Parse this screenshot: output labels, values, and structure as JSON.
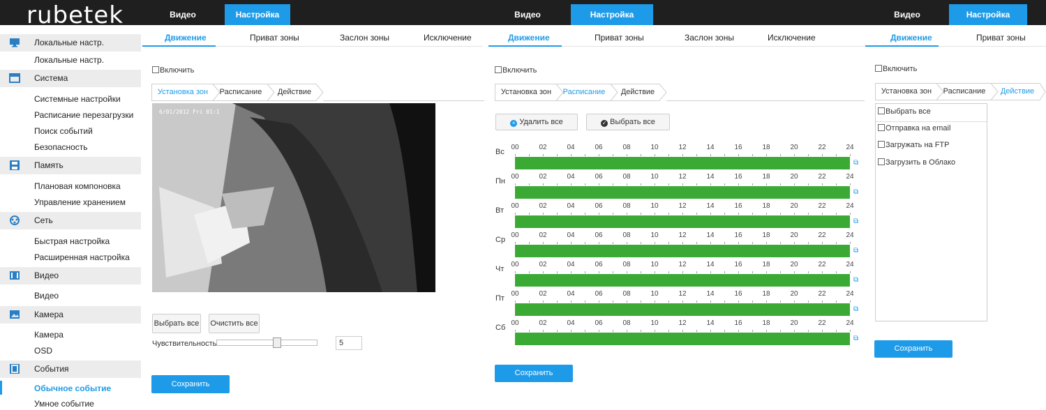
{
  "brand": {
    "logo": "rubetek"
  },
  "topnav": {
    "video": "Видео",
    "settings": "Настройка"
  },
  "sidebar": {
    "groups": [
      {
        "label": "Локальные настр.",
        "icon": "monitor-icon",
        "items": [
          "Локальные настр."
        ]
      },
      {
        "label": "Система",
        "icon": "system-icon",
        "items": [
          "Системные настройки",
          "Расписание перезагрузки",
          "Поиск событий",
          "Безопасность"
        ]
      },
      {
        "label": "Память",
        "icon": "storage-icon",
        "items": [
          "Плановая компоновка",
          "Управление хранением"
        ]
      },
      {
        "label": "Сеть",
        "icon": "network-icon",
        "items": [
          "Быстрая настройка",
          "Расширенная настройка"
        ]
      },
      {
        "label": "Видео",
        "icon": "video-icon",
        "items": [
          "Видео"
        ]
      },
      {
        "label": "Камера",
        "icon": "camera-icon",
        "items": [
          "Камера",
          "OSD"
        ]
      },
      {
        "label": "События",
        "icon": "events-icon",
        "items": [
          "Обычное событие",
          "Умное событие"
        ]
      }
    ],
    "selected_item": "Обычное событие"
  },
  "tabs": [
    "Движение",
    "Приват зоны",
    "Заслон зоны",
    "Исключение"
  ],
  "enable_label": "Включить",
  "steps": [
    "Установка зон",
    "Расписание",
    "Действие"
  ],
  "panel1": {
    "timestamp": "6/01/2012 Fri 01:1",
    "select_all": "Выбрать все",
    "clear_all": "Очистить все",
    "sensitivity_label": "Чувствительность",
    "sensitivity_value": "5",
    "sensitivity_level": 0.6,
    "save": "Сохранить"
  },
  "panel2": {
    "delete_all": "Удалить все",
    "select_all": "Выбрать все",
    "days": [
      "Вс",
      "Пн",
      "Вт",
      "Ср",
      "Чт",
      "Пт",
      "Сб"
    ],
    "hours": [
      "00",
      "02",
      "04",
      "06",
      "08",
      "10",
      "12",
      "14",
      "16",
      "18",
      "20",
      "22",
      "24"
    ],
    "schedule_color": "#3aaa35",
    "save": "Сохранить"
  },
  "panel3": {
    "actions": [
      "Выбрать все",
      "Отправка на email",
      "Загружать на FTP",
      "Загрузить в Облако"
    ],
    "save": "Сохранить"
  },
  "colors": {
    "accent": "#1e9be8",
    "topbar": "#1f1f1f",
    "schedule": "#3aaa35"
  }
}
